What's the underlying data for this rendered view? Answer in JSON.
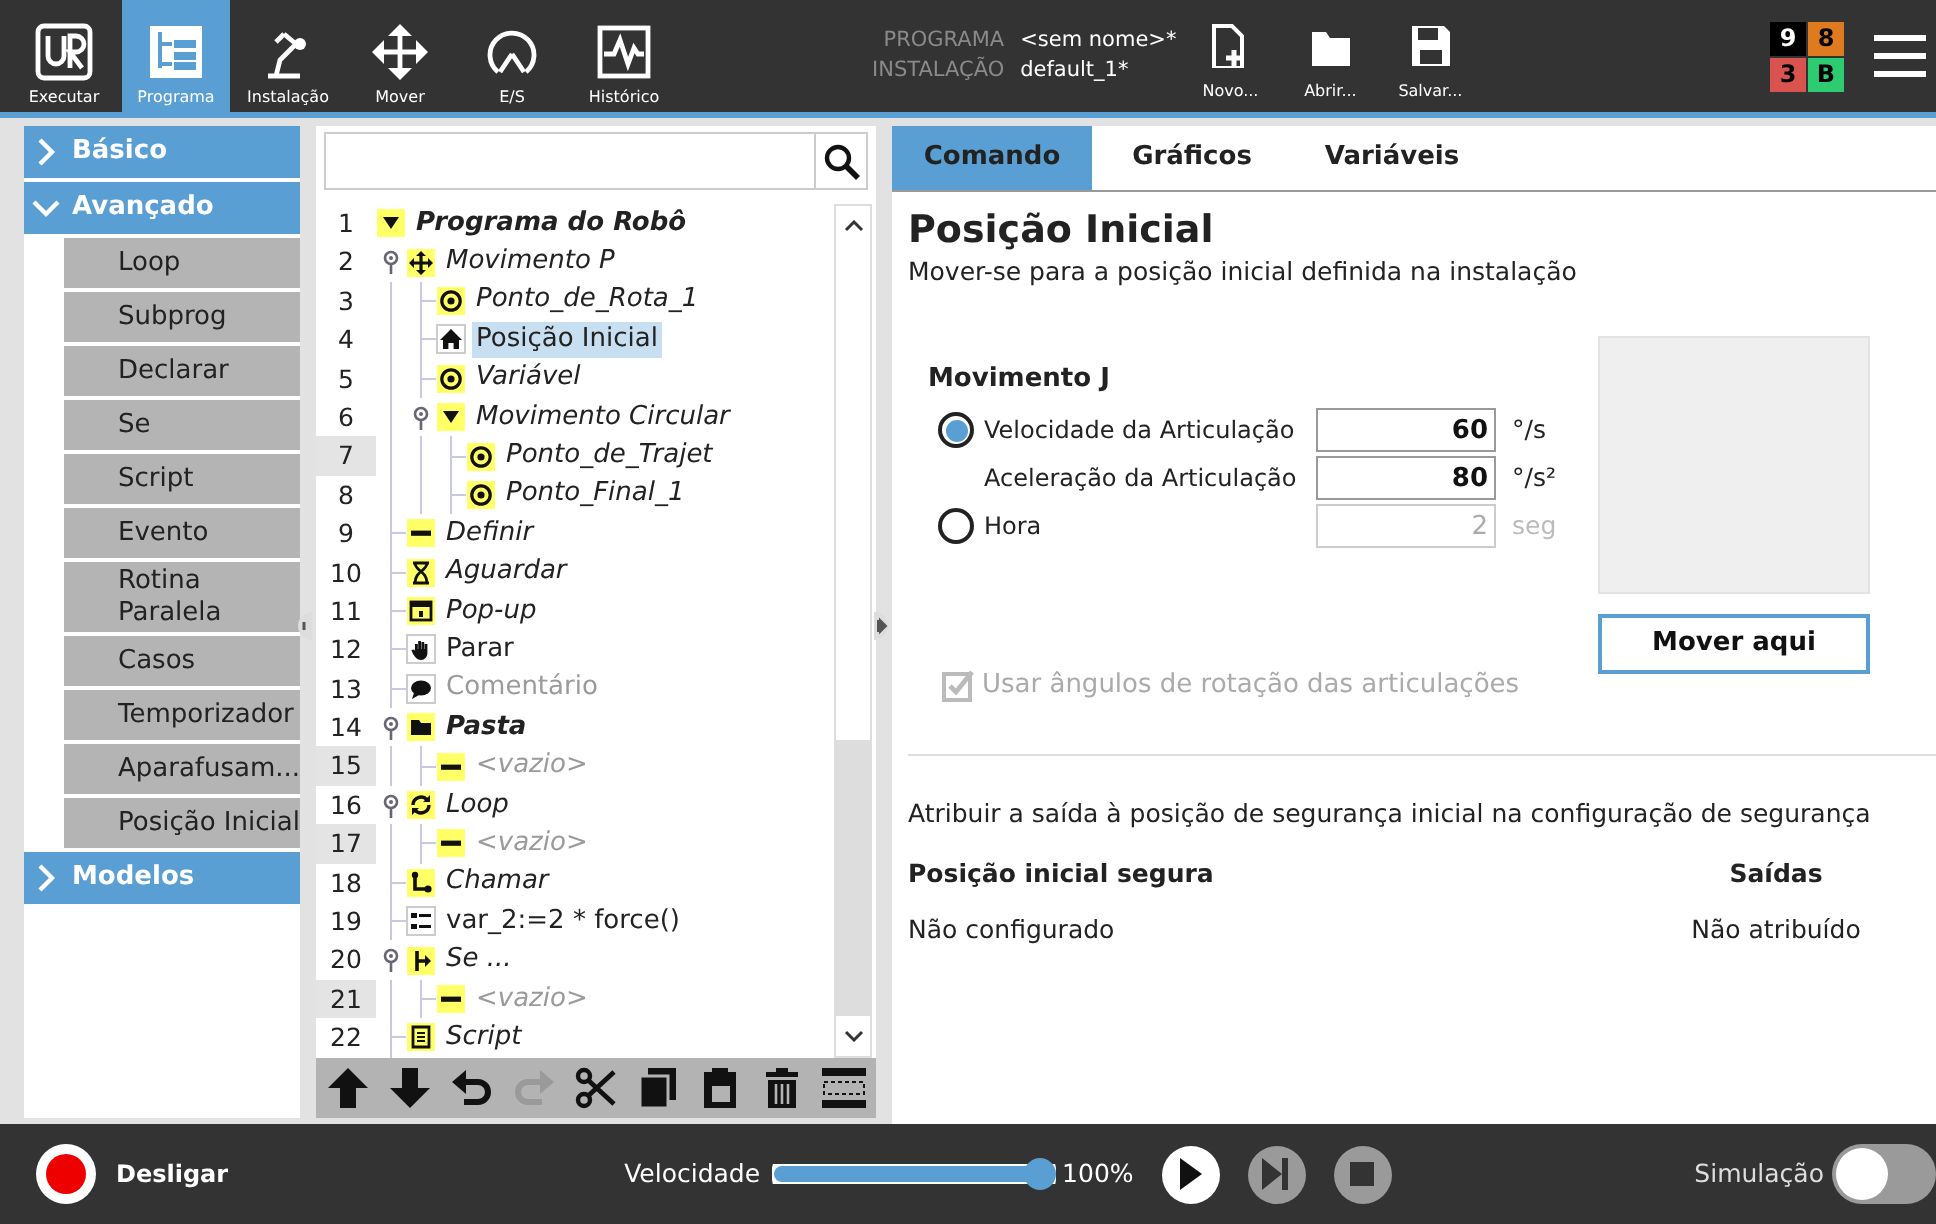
{
  "header": {
    "nav_tabs": [
      {
        "kind": "run",
        "label": "Executar",
        "selected": false
      },
      {
        "kind": "program",
        "label": "Programa",
        "selected": true
      },
      {
        "kind": "installation",
        "label": "Instalação",
        "selected": false
      },
      {
        "kind": "move",
        "label": "Mover",
        "selected": false
      },
      {
        "kind": "io",
        "label": "E/S",
        "selected": false
      },
      {
        "kind": "log",
        "label": "Histórico",
        "selected": false
      }
    ],
    "program_info": [
      {
        "label": "PROGRAMA",
        "value": "<sem nome>*"
      },
      {
        "label": "INSTALAÇÃO",
        "value": "default_1*"
      }
    ],
    "file_buttons": [
      {
        "kind": "new",
        "label": "Novo..."
      },
      {
        "kind": "open",
        "label": "Abrir..."
      },
      {
        "kind": "save",
        "label": "Salvar..."
      }
    ],
    "status_codes": [
      {
        "text": "9",
        "color": "#000000"
      },
      {
        "text": "8",
        "color": "#e07a1e"
      },
      {
        "text": "3",
        "color": "#d9534f"
      },
      {
        "text": "B",
        "color": "#2ecc71"
      }
    ]
  },
  "sidebar": [
    {
      "label": "Básico",
      "expanded": false
    },
    {
      "label": "Avançado",
      "expanded": true,
      "items": [
        "Loop",
        "Subprog",
        "Declarar",
        "Se",
        "Script",
        "Evento",
        "Rotina Paralela",
        "Casos",
        "Temporizador",
        "Aparafusam...",
        "Posição Inicial"
      ]
    },
    {
      "label": "Modelos",
      "expanded": false
    }
  ],
  "program_tree": {
    "nodes": [
      {
        "number": "1",
        "label": "Programa do Robô",
        "kind": "program",
        "incomplete": true,
        "selected": false,
        "flagged": false,
        "children": [
          {
            "number": "2",
            "label": "Movimento P",
            "kind": "move",
            "incomplete": true,
            "selected": false,
            "flagged": false,
            "expanded": true,
            "children": [
              {
                "number": "3",
                "label": "Ponto_de_Rota_1",
                "kind": "waypoint",
                "incomplete": true,
                "selected": false,
                "flagged": false
              },
              {
                "number": "4",
                "label": "Posição Inicial",
                "kind": "home",
                "incomplete": false,
                "selected": true,
                "flagged": false
              },
              {
                "number": "5",
                "label": "Variável",
                "kind": "waypoint",
                "incomplete": true,
                "selected": false,
                "flagged": false
              },
              {
                "number": "6",
                "label": "Movimento Circular",
                "kind": "circle_move",
                "incomplete": true,
                "selected": false,
                "flagged": false,
                "expanded": true,
                "children": [
                  {
                    "number": "7",
                    "label": "Ponto_de_Trajet",
                    "kind": "waypoint",
                    "incomplete": true,
                    "selected": false,
                    "flagged": true
                  },
                  {
                    "number": "8",
                    "label": "Ponto_Final_1",
                    "kind": "waypoint",
                    "incomplete": true,
                    "selected": false,
                    "flagged": false
                  }
                ]
              }
            ]
          },
          {
            "number": "9",
            "label": "Definir",
            "kind": "set",
            "incomplete": true,
            "selected": false,
            "flagged": false
          },
          {
            "number": "10",
            "label": "Aguardar",
            "kind": "wait",
            "incomplete": true,
            "selected": false,
            "flagged": false
          },
          {
            "number": "11",
            "label": "Pop-up",
            "kind": "popup",
            "incomplete": true,
            "selected": false,
            "flagged": false
          },
          {
            "number": "12",
            "label": "Parar",
            "kind": "stop",
            "incomplete": false,
            "selected": false,
            "flagged": false
          },
          {
            "number": "13",
            "label": "Comentário",
            "kind": "comment",
            "incomplete": false,
            "selected": false,
            "flagged": false
          },
          {
            "number": "14",
            "label": "Pasta",
            "kind": "folder",
            "incomplete": true,
            "selected": false,
            "flagged": false,
            "expanded": true,
            "children": [
              {
                "number": "15",
                "label": "<vazio>",
                "kind": "empty",
                "incomplete": true,
                "selected": false,
                "flagged": true
              }
            ]
          },
          {
            "number": "16",
            "label": "Loop",
            "kind": "loop",
            "incomplete": true,
            "selected": false,
            "flagged": false,
            "expanded": true,
            "children": [
              {
                "number": "17",
                "label": "<vazio>",
                "kind": "empty",
                "incomplete": true,
                "selected": false,
                "flagged": true
              }
            ]
          },
          {
            "number": "18",
            "label": "Chamar",
            "kind": "call",
            "incomplete": true,
            "selected": false,
            "flagged": false
          },
          {
            "number": "19",
            "label": "var_2:=2 * force()",
            "kind": "assign",
            "incomplete": false,
            "selected": false,
            "flagged": false
          },
          {
            "number": "20",
            "label": "Se ...",
            "kind": "if",
            "incomplete": true,
            "selected": false,
            "flagged": false,
            "expanded": true,
            "children": [
              {
                "number": "21",
                "label": "<vazio>",
                "kind": "empty",
                "incomplete": true,
                "selected": false,
                "flagged": true
              }
            ]
          },
          {
            "number": "22",
            "label": "Script",
            "kind": "script",
            "incomplete": true,
            "selected": false,
            "flagged": false
          }
        ]
      }
    ],
    "toolbar": [
      {
        "kind": "up",
        "disabled": false
      },
      {
        "kind": "down",
        "disabled": false
      },
      {
        "kind": "undo",
        "disabled": false
      },
      {
        "kind": "redo",
        "disabled": true
      },
      {
        "kind": "cut",
        "disabled": false
      },
      {
        "kind": "copy",
        "disabled": false
      },
      {
        "kind": "paste",
        "disabled": false
      },
      {
        "kind": "delete",
        "disabled": false
      },
      {
        "kind": "suppress",
        "disabled": false
      }
    ]
  },
  "command_panel": {
    "tabs": [
      {
        "label": "Comando",
        "selected": true
      },
      {
        "label": "Gráficos",
        "selected": false
      },
      {
        "label": "Variáveis",
        "selected": false
      }
    ],
    "title": "Posição Inicial",
    "subtitle": "Mover-se para a posição inicial definida na instalação",
    "move_section": {
      "title": "Movimento J",
      "rows": [
        {
          "kind": "radio",
          "label": "Velocidade da Articulação",
          "selected": true,
          "value": "60",
          "unit": "°/s",
          "disabled": false
        },
        {
          "kind": "plain",
          "label": "Aceleração da Articulação",
          "value": "80",
          "unit": "°/s²",
          "disabled": false
        },
        {
          "kind": "radio",
          "label": "Hora",
          "selected": false,
          "value": "2",
          "unit": "seg",
          "disabled": true
        }
      ]
    },
    "joint_angles_checkbox": {
      "label": "Usar ângulos de rotação das articulações",
      "checked": true,
      "disabled": true
    },
    "move_here_button": "Mover aqui",
    "safety": {
      "description": "Atribuir a saída à posição de segurança inicial na configuração de segurança",
      "columns": [
        "Posição inicial segura",
        "Saídas"
      ],
      "values": [
        "Não configurado",
        "Não atribuído"
      ]
    }
  },
  "footer": {
    "power_label": "Desligar",
    "speed": {
      "label": "Velocidade",
      "level": 1.0,
      "reading": "100%"
    },
    "playback": [
      {
        "kind": "play",
        "disabled": false
      },
      {
        "kind": "step",
        "disabled": true
      },
      {
        "kind": "stop",
        "disabled": true
      }
    ],
    "simulation": {
      "label": "Simulação",
      "on": false
    }
  }
}
